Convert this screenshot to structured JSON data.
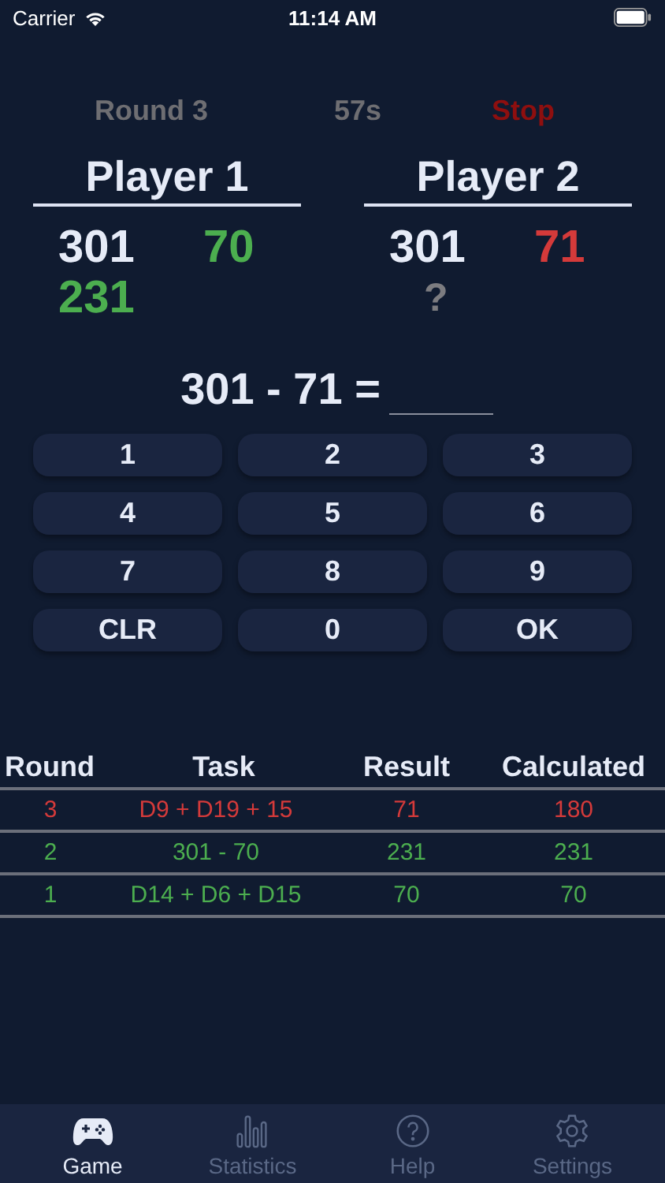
{
  "status_bar": {
    "carrier": "Carrier",
    "time": "11:14 AM"
  },
  "header": {
    "round": "Round 3",
    "timer": "57s",
    "stop": "Stop"
  },
  "players": [
    {
      "name": "Player 1",
      "score": "301",
      "throw": {
        "text": "70",
        "color": "#4cae4f"
      },
      "result": {
        "text": "231",
        "color": "#4cae4f"
      }
    },
    {
      "name": "Player 2",
      "score": "301",
      "throw": {
        "text": "71",
        "color": "#d43a3a"
      },
      "result": {
        "text": "?",
        "color": "#7c7c80"
      }
    }
  ],
  "equation": {
    "text": "301 - 71 ="
  },
  "keypad": [
    "1",
    "2",
    "3",
    "4",
    "5",
    "6",
    "7",
    "8",
    "9",
    "CLR",
    "0",
    "OK"
  ],
  "history": {
    "columns": [
      "Round",
      "Task",
      "Result",
      "Calculated"
    ],
    "rows": [
      {
        "cells": [
          "3",
          "D9 + D19 + 15",
          "71",
          "180"
        ],
        "color": "#d43a3a"
      },
      {
        "cells": [
          "2",
          "301 - 70",
          "231",
          "231"
        ],
        "color": "#4cae4f"
      },
      {
        "cells": [
          "1",
          "D14 + D6 + D15",
          "70",
          "70"
        ],
        "color": "#4cae4f"
      }
    ]
  },
  "tabs": [
    {
      "label": "Game",
      "kind": "game",
      "selected": true
    },
    {
      "label": "Statistics",
      "kind": "stats",
      "selected": false
    },
    {
      "label": "Help",
      "kind": "help",
      "selected": false
    },
    {
      "label": "Settings",
      "kind": "settings",
      "selected": false
    }
  ]
}
